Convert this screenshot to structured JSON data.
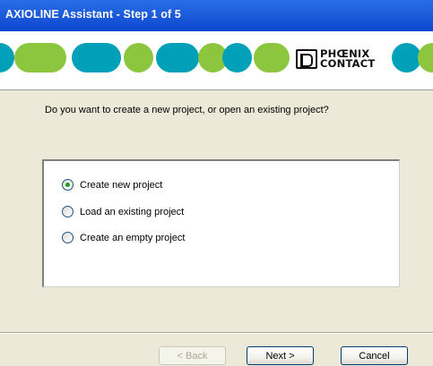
{
  "window": {
    "title": "AXIOLINE Assistant - Step 1 of 5"
  },
  "banner": {
    "brand_line1": "PHŒNIX",
    "brand_line2": "CONTACT",
    "colors": {
      "blue": "#00a0b8",
      "green": "#8cc63f"
    }
  },
  "main": {
    "question": "Do you want to create a new project, or open an existing project?",
    "options": [
      {
        "label": "Create new project",
        "checked": true
      },
      {
        "label": "Load an existing project",
        "checked": false
      },
      {
        "label": "Create an empty project",
        "checked": false
      }
    ]
  },
  "buttons": {
    "back": "< Back",
    "next": "Next >",
    "cancel": "Cancel"
  }
}
